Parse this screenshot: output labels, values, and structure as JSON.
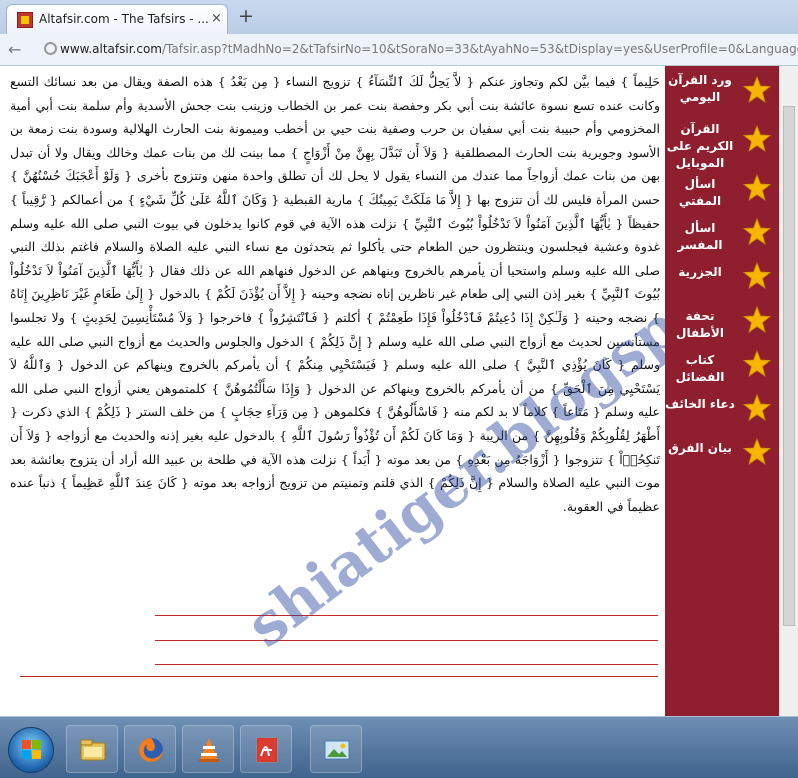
{
  "browser": {
    "tab_title": "Altafsir.com - The Tafsirs - ...",
    "tab_close": "×",
    "new_tab": "+",
    "url_domain": "www.altafsir.com",
    "url_path": "/Tafsir.asp?tMadhNo=2&tTafsirNo=10&tSoraNo=33&tAyahNo=53&tDisplay=yes&UserProfile=0&LanguageId=1"
  },
  "sidebar": {
    "items": [
      {
        "label": "ورد القرآن اليومي"
      },
      {
        "label": "القرآن الكريم على الموبايل"
      },
      {
        "label": "اسأل المفتي"
      },
      {
        "label": "اسأل المفسر"
      },
      {
        "label": "الجزرية"
      },
      {
        "label": "تحفة الأطفال"
      },
      {
        "label": "كتاب الفضائل"
      },
      {
        "label": "دعاء الخائف"
      },
      {
        "label": "بيان الفرق"
      }
    ]
  },
  "article": {
    "text": "حَلِيماً } فيما بيَّن لكم وتجاوز عنكم { لاَّ يَحِلُّ لَكَ ٱلنِّسَآءُ } تزويج النساء { مِن بَعْدُ } هذه الصفة ويقال من بعد نسائك التسع وكانت عنده تسع نسوة عائشة بنت أبي بكر وحفصة بنت عمر بن الخطاب وزينب بنت جحش الأسدية وأم سلمة بنت أبي أمية المخزومي وأم حبيبة بنت أبي سفيان بن حرب وصفية بنت حيي بن أخطب وميمونة بنت الحارث الهلالية وسودة بنت زمعة بن الأسود وجويرية بنت الحارث المصطلقية { وَلاَ أَن تَبَدَّلَ بِهِنَّ مِنْ أَزْوَاجٍ } مما بينت لك من بنات عمك وخالك ويقال ولا أن تبدل بهن من بنات عمك أزواجاً مما عندك من النساء يقول لا يحل لك أن تطلق واحدة منهن وتتزوج بأخرى { وَلَوْ أَعْجَبَكَ حُسْنُهُنَّ } حسن المرأة فليس لك أن تتزوج بها { إِلاَّ مَا مَلَكَتْ يَمِينُكَ } مارية القبطية { وَكَانَ ٱللَّهُ عَلَىٰ كُلِّ شَيْءٍ } من أعمالكم { رَّقِيباً } حفيظاً { يٰأَيُّهَا ٱلَّذِينَ آمَنُواْ لاَ تَدْخُلُواْ بُيُوتَ ٱلنَّبِيِّ } نزلت هذه الآية في قوم كانوا يدخلون في بيوت النبي صلى الله عليه وسلم غدوة وعشية فيجلسون وينتظرون حين الطعام حتى يأكلوا ثم يتحدثون مع نساء النبي عليه الصلاة والسلام فاغتم بذلك النبي صلى الله عليه وسلم واستحيا أن يأمرهم بالخروج وينهاهم عن الدخول فنهاهم الله عن ذلك فقال { يٰأَيُّهَا ٱلَّذِينَ آمَنُواْ لاَ تَدْخُلُواْ بُيُوتَ ٱلنَّبِيِّ } بغير إذن النبي إلى طعام غير ناظرين إناه نضجه وحينه { إِلاَّ أَن يُؤْذَنَ لَكُمْ } بالدخول { إِلَىٰ طَعَامٍ غَيْرَ نَاظِرِينَ إِنَاهُ } نضجه وحينه { وَلَـٰكِنْ إِذَا دُعِيتُمْ فَٱدْخُلُواْ فَإِذَا طَعِمْتُمْ } أكلتم { فَٱنْتَشِرُواْ } فاخرجوا { وَلاَ مُسْتَأْنِسِينَ لِحَدِيثٍ } ولا تجلسوا مستأنسين لحديث مع أزواج النبي صلى الله عليه وسلم { إِنَّ ذَلِكُمْ } الدخول والجلوس والحديث مع أزواج النبي صلى الله عليه وسلم { كَانَ يُؤْذِي ٱلنَّبِيَّ } صلى الله عليه وسلم { فَيَسْتَحْيِي مِنكُمْ } أن يأمركم بالخروج وينهاكم عن الدخول { وَٱللَّهُ لاَ يَسْتَحْيِي مِنَ ٱلْحَقِّ } من أن يأمركم بالخروج وينهاكم عن الدخول { وَإِذَا سَأَلْتُمُوهُنَّ } كلمتموهن يعني أزواج النبي صلى الله عليه وسلم { مَتَاعاً } كلاماً لا بد لكم منه { فَاسْأَلُوهُنَّ } فكلموهن { مِن وَرَآءِ حِجَابٍ } من خلف الستر { ذَلِكُمْ } الذي ذكرت { أَطْهَرُ لِقُلُوبِكُمْ وَقُلُوبِهِنَّ } من الريبة { وَمَا كَانَ لَكُمْ أَن تُؤْذُواْ رَسُولَ ٱللَّهِ } بالدخول عليه بغير إذنه والحديث مع أزواجه { وَلاَ أَن تَنكِحُوۤاْ } تتزوجوا { أَزْوَاجَهُ مِن بَعْدِهِ } من بعد موته { أَبَداً } نزلت هذه الآية في طلحة بن عبيد الله أراد أن يتزوج بعائشة بعد موت النبي عليه الصلاة والسلام { إِنَّ ذَلِكُمْ } الذي قلتم وتمنيتم من تزويج أزواجه بعد موته { كَانَ عِندَ ٱللَّهِ عَظِيماً } ذنباً عنده عظيماً في العقوبة."
  },
  "watermark": {
    "text": "shiatiger.blogspot.com"
  },
  "taskbar": {
    "apps": [
      {
        "icon": "windows-explorer-icon"
      },
      {
        "icon": "firefox-icon"
      },
      {
        "icon": "vlc-icon"
      },
      {
        "icon": "pdf-reader-icon"
      },
      {
        "icon": "photo-viewer-icon"
      }
    ]
  },
  "colors": {
    "sidebar_bg": "#8f1f2e",
    "star": "#f7b500",
    "underline": "#c62828",
    "watermark": "#2846a0"
  }
}
